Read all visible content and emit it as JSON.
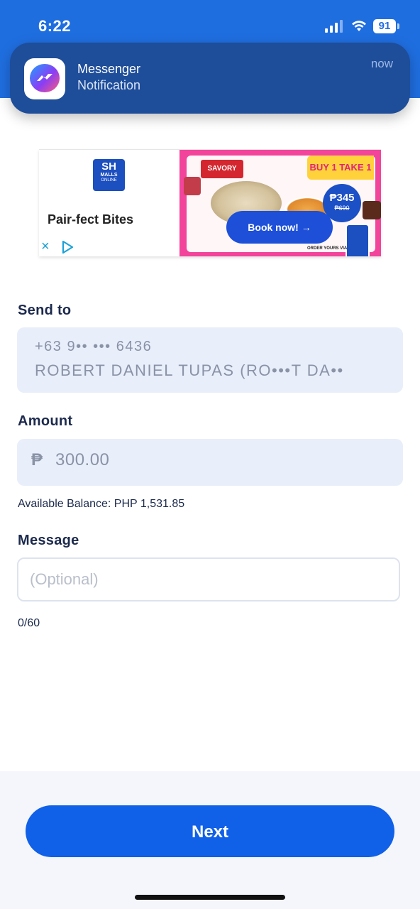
{
  "status_bar": {
    "time": "6:22",
    "battery": "91"
  },
  "notification": {
    "app": "Messenger",
    "text": "Notification",
    "time": "now"
  },
  "ad": {
    "brand_logo": "SH",
    "brand_logo_malls": "MALLS",
    "brand_logo_online": "ONLINE",
    "title": "Pair-fect Bites",
    "close_icon": "×",
    "restaurant": "SAVORY",
    "promo": "BUY 1 TAKE 1",
    "price": "₱345",
    "old_price": "₱690",
    "cta": "Book now! →",
    "order_text": "ORDER YOURS VIA"
  },
  "form": {
    "send_to_label": "Send to",
    "recipient_number": "+63 9•• ••• 6436",
    "recipient_name": "ROBERT DANIEL TUPAS (RO•••T DA••",
    "amount_label": "Amount",
    "currency_symbol": "₱",
    "amount_value": "300.00",
    "balance_text": "Available Balance: PHP 1,531.85",
    "message_label": "Message",
    "message_placeholder": "(Optional)",
    "char_count": "0/60"
  },
  "next_button": "Next",
  "colors": {
    "primary": "#1060e8",
    "header": "#1f6ee0",
    "notification_bg": "#1e4d9a",
    "field_bg": "#e8eefa",
    "ad_pink": "#f2449a"
  }
}
